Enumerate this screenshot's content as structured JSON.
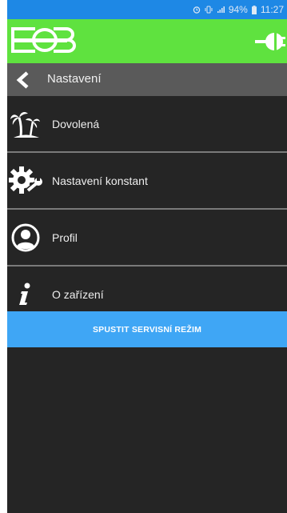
{
  "status_bar": {
    "battery_percent": "94%",
    "time": "11:27",
    "icons": [
      "alarm-icon",
      "vibrate-icon",
      "signal-icon",
      "battery-icon"
    ]
  },
  "app_bar": {
    "logo_text": "EOB",
    "icons": [
      "eob-logo",
      "plug-icon"
    ],
    "color": "#5fe23f"
  },
  "header": {
    "title": "Nastavení",
    "back_icon": "chevron-left-icon"
  },
  "menu": {
    "items": [
      {
        "label": "Dovolená",
        "icon": "palm-tree-icon"
      },
      {
        "label": "Nastavení konstant",
        "icon": "gear-wrench-icon"
      },
      {
        "label": "Profil",
        "icon": "user-circle-icon"
      },
      {
        "label": "O zařízení",
        "icon": "info-icon"
      }
    ]
  },
  "action_button": {
    "label": "SPUSTIT SERVISNÍ REŽIM",
    "color": "#3fa6f5"
  },
  "colors": {
    "background": "#252525",
    "header_bar": "#5a5a5a",
    "status_bar": "#1e88e5"
  }
}
